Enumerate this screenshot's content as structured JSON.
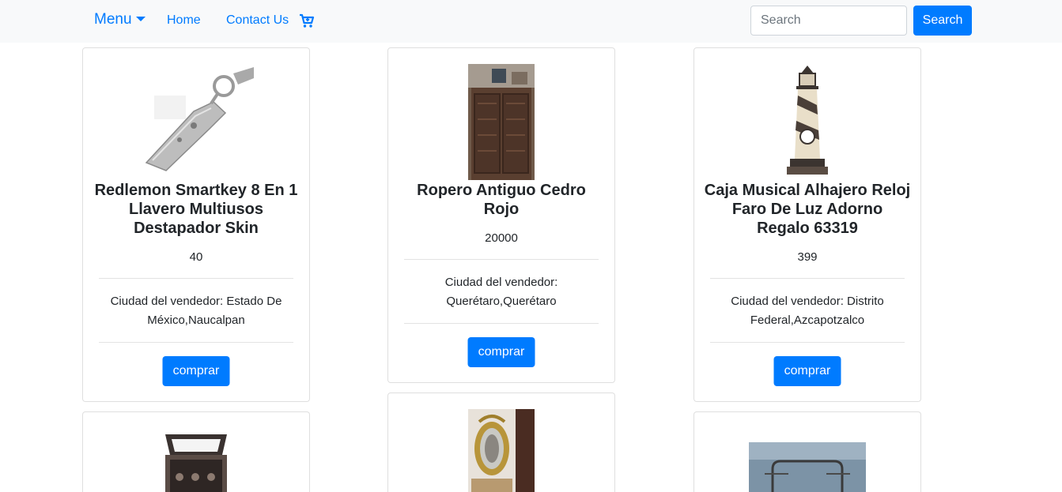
{
  "navbar": {
    "menu_label": "Menu",
    "home_label": "Home",
    "contact_label": "Contact Us",
    "cart_icon": "cart-plus-icon",
    "search_placeholder": "Search",
    "search_button_label": "Search"
  },
  "products": [
    {
      "title": "Redlemon Smartkey 8 En 1 Llavero Multiusos Destapador Skin",
      "price": "40",
      "city": "Ciudad del vendedor: Estado De México,Naucalpan",
      "buy_label": "comprar"
    },
    {
      "title": "Ropero Antiguo Cedro Rojo",
      "price": "20000",
      "city": "Ciudad del vendedor: Querétaro,Querétaro",
      "buy_label": "comprar"
    },
    {
      "title": "Caja Musical Alhajero Reloj Faro De Luz Adorno Regalo 63319",
      "price": "399",
      "city": "Ciudad del vendedor: Distrito Federal,Azcapotzalco",
      "buy_label": "comprar"
    }
  ],
  "colors": {
    "primary": "#007bff",
    "navbar_bg": "#f8f9fa"
  }
}
